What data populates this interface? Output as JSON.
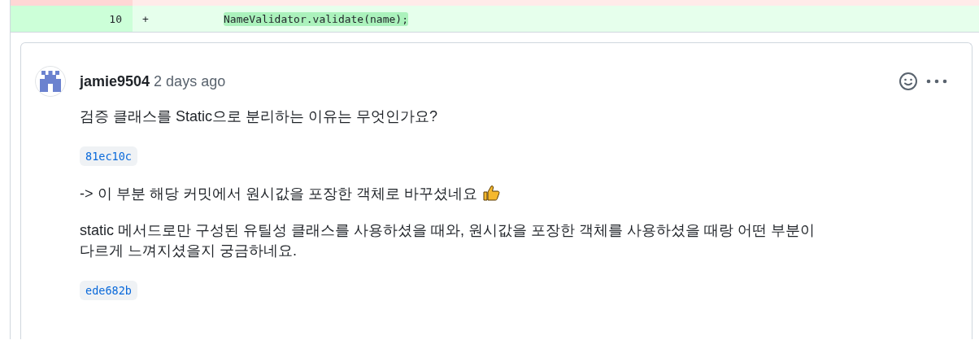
{
  "diff": {
    "deleted_row": {
      "kind": "deleted"
    },
    "added_row": {
      "line_number": "10",
      "sign": "+",
      "code": "NameValidator.validate(name);"
    }
  },
  "comment": {
    "author": "jamie9504",
    "time": "2 days ago",
    "body": [
      {
        "kind": "text",
        "text": "검증 클래스를 Static으로 분리하는 이유는 무엇인가요?"
      },
      {
        "kind": "commit",
        "text": "81ec10c"
      },
      {
        "kind": "text",
        "text": "-> 이 부분 해당 커밋에서 원시값을 포장한 객체로 바꾸셨네요",
        "thumbs_up": true
      },
      {
        "kind": "text",
        "text": "static 메서드로만 구성된 유틸성 클래스를 사용하셨을 때와, 원시값을 포장한 객체를 사용하셨을 때랑 어떤 부분이 다르게 느껴지셨을지 궁금하네요."
      },
      {
        "kind": "commit",
        "text": "ede682b"
      }
    ]
  }
}
